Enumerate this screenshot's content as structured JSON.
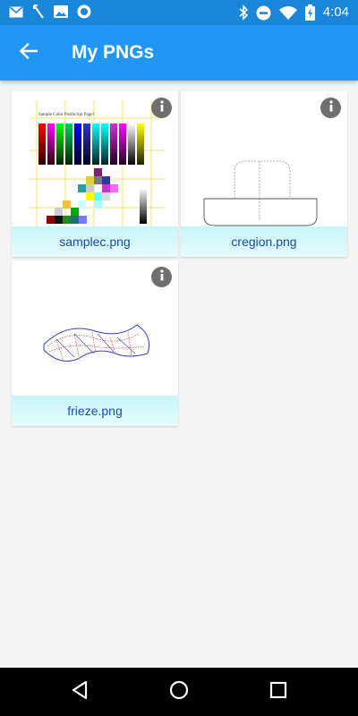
{
  "status_bar": {
    "time": "4:04",
    "left_icons": [
      "gmail-icon",
      "missed-call-icon",
      "image-icon",
      "circle-app-icon"
    ],
    "right_icons": [
      "bluetooth-icon",
      "do-not-disturb-icon",
      "wifi-icon",
      "battery-charging-icon"
    ]
  },
  "app_bar": {
    "title": "My PNGs",
    "back_icon": "arrow-back-icon"
  },
  "files": [
    {
      "name": "samplec.png",
      "info_icon": "info-icon"
    },
    {
      "name": "cregion.png",
      "info_icon": "info-icon"
    },
    {
      "name": "frieze.png",
      "info_icon": "info-icon"
    }
  ],
  "thumbnail_text": {
    "samplec_heading": "Sample Color PostScript Page!"
  },
  "nav_bar": {
    "icons": [
      "back-triangle-icon",
      "home-circle-icon",
      "recents-square-icon"
    ]
  },
  "colors": {
    "status_bar": "#1a86d9",
    "app_bar": "#2196f3",
    "caption_bg": "#d4f8fc",
    "caption_text": "#1a4aa8",
    "info_button": "#6f6f6f",
    "background": "#f4f4f4"
  }
}
